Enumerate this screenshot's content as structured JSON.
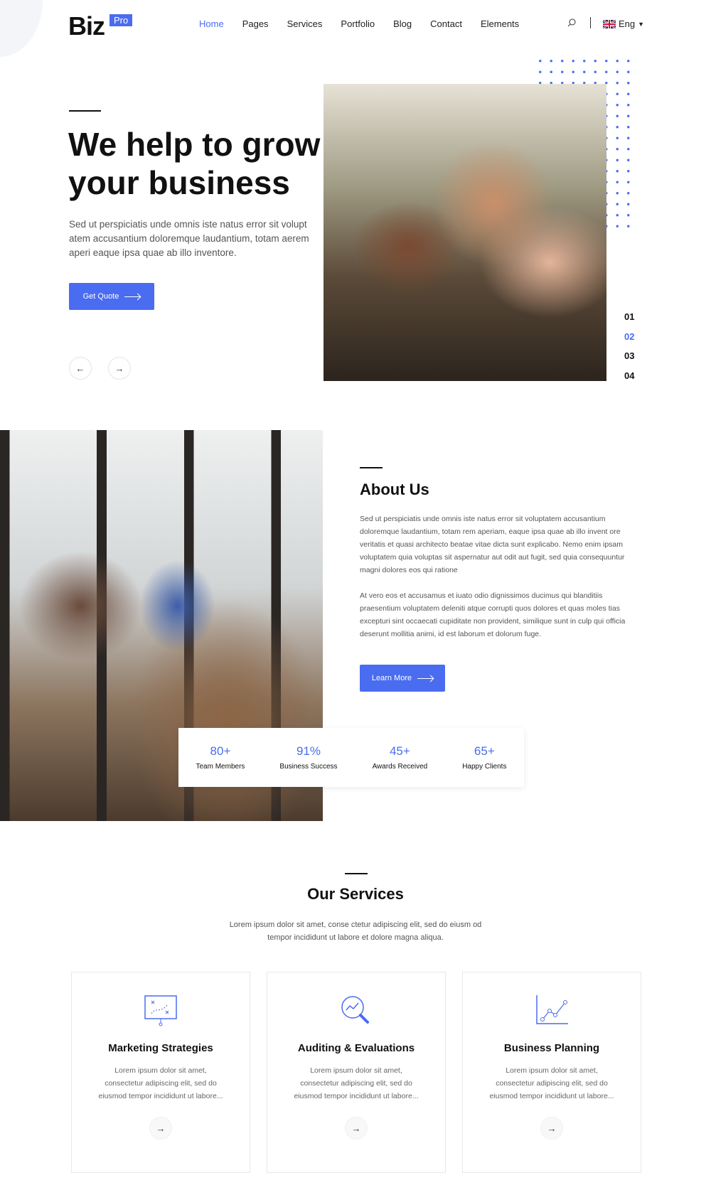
{
  "header": {
    "logo": "Biz",
    "badge": "Pro",
    "nav": [
      "Home",
      "Pages",
      "Services",
      "Portfolio",
      "Blog",
      "Contact",
      "Elements"
    ],
    "active": "Home",
    "language": "Eng",
    "icons": [
      "search-icon",
      "uk-flag-icon",
      "caret-down-icon"
    ]
  },
  "hero": {
    "title": "We help to grow your business",
    "text": "Sed ut perspiciatis unde omnis iste natus error sit volupt atem accusantium doloremque laudantium, totam aerem aperi eaque ipsa quae ab illo inventore.",
    "button": "Get Quote",
    "slides": [
      "01",
      "02",
      "03",
      "04"
    ],
    "active_slide": "02"
  },
  "about": {
    "title": "About Us",
    "p1": "Sed ut perspiciatis unde omnis iste natus error sit voluptatem accusantium doloremque laudantium, totam rem aperiam, eaque ipsa quae ab illo invent ore veritatis et quasi architecto beatae vitae dicta sunt explicabo. Nemo enim ipsam voluptatem quia voluptas sit aspernatur aut odit aut fugit, sed quia consequuntur magni dolores eos qui ratione",
    "p2": "At vero eos et accusamus et iuato odio dignissimos ducimus qui blanditiis praesentium voluptatem deleniti atque corrupti quos dolores et quas moles tias excepturi sint occaecati cupiditate non provident, similique sunt in culp qui officia deserunt mollitia animi, id est laborum et dolorum fuge.",
    "button": "Learn More"
  },
  "stats": [
    {
      "value": "80+",
      "label": "Team Members"
    },
    {
      "value": "91%",
      "label": "Business Success"
    },
    {
      "value": "45+",
      "label": "Awards Received"
    },
    {
      "value": "65+",
      "label": "Happy Clients"
    }
  ],
  "services": {
    "title": "Our Services",
    "subtitle": "Lorem ipsum dolor sit amet, conse ctetur adipiscing elit, sed do eiusm od tempor incididunt ut labore et dolore magna aliqua.",
    "cards": [
      {
        "title": "Marketing Strategies",
        "text": "Lorem ipsum dolor sit amet, consectetur adipiscing elit, sed do eiusmod tempor incididunt ut labore...",
        "icon": "strategy-board-icon"
      },
      {
        "title": "Auditing & Evaluations",
        "text": "Lorem ipsum dolor sit amet, consectetur adipiscing elit, sed do eiusmod tempor incididunt ut labore...",
        "icon": "magnifier-chart-icon"
      },
      {
        "title": "Business Planning",
        "text": "Lorem ipsum dolor sit amet, consectetur adipiscing elit, sed do eiusmod tempor incididunt ut labore...",
        "icon": "line-chart-icon"
      }
    ]
  },
  "colors": {
    "accent": "#4a6cf0"
  }
}
